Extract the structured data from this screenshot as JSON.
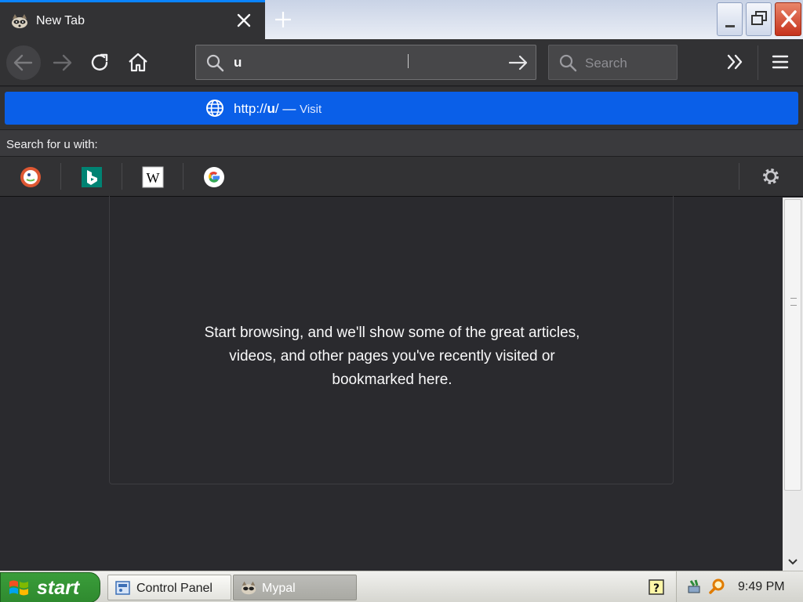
{
  "tab": {
    "title": "New Tab"
  },
  "urlbar": {
    "value": "u"
  },
  "searchbar": {
    "placeholder": "Search"
  },
  "popup": {
    "suggestion": {
      "prefix": "http://",
      "bold": "u",
      "suffix": "/",
      "dash": " — ",
      "action": "Visit"
    },
    "search_for": "Search for u with:",
    "engines": [
      "duckduckgo",
      "bing",
      "wikipedia",
      "google"
    ]
  },
  "content": {
    "message": "Start browsing, and we'll show some of the great articles, videos, and other pages you've recently visited or bookmarked here."
  },
  "taskbar": {
    "start_label": "start",
    "items": [
      {
        "label": "Control Panel"
      },
      {
        "label": "Mypal"
      }
    ],
    "clock": "9:49 PM"
  },
  "colors": {
    "accent": "#0a5fe8",
    "toolbar": "#323234",
    "content_bg": "#2a2a2e",
    "start_green": "#3a9d3a"
  }
}
